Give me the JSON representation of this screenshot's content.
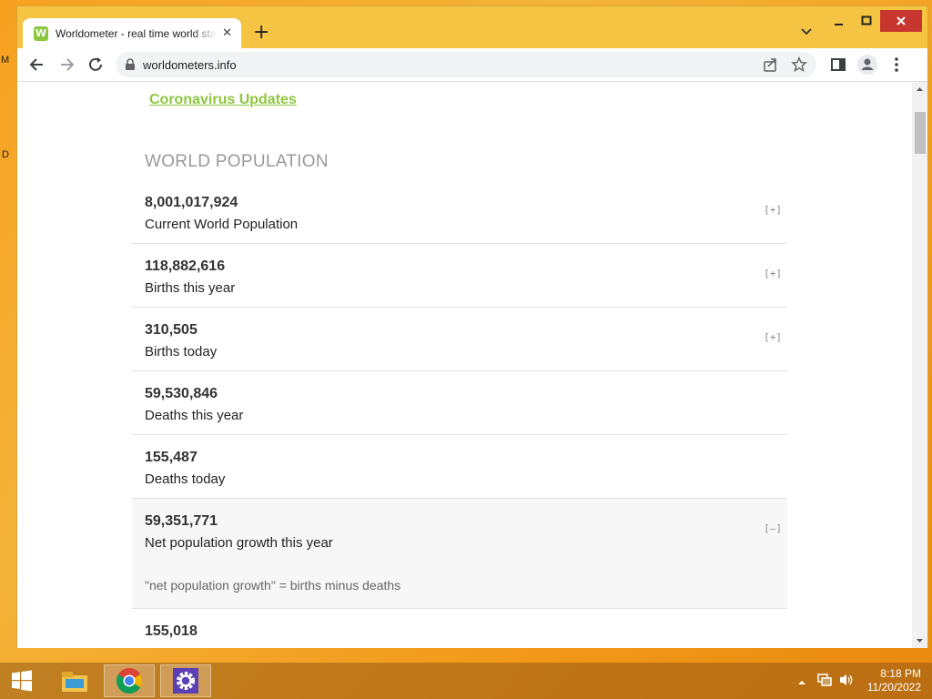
{
  "browser": {
    "tab_title": "Worldometer - real time world statistics",
    "favicon_letter": "W",
    "url": "worldometers.info"
  },
  "page": {
    "covid_link": "Coronavirus Updates",
    "section_title": "WORLD POPULATION",
    "rows": [
      {
        "value": "8,001,017,924",
        "label": "Current World Population",
        "toggle": "[+]"
      },
      {
        "value": "118,882,616",
        "label": "Births this year",
        "toggle": "[+]"
      },
      {
        "value": "310,505",
        "label": "Births today",
        "toggle": "[+]"
      },
      {
        "value": "59,530,846",
        "label": "Deaths this year",
        "toggle": ""
      },
      {
        "value": "155,487",
        "label": "Deaths today",
        "toggle": ""
      },
      {
        "value": "59,351,771",
        "label": "Net population growth this year",
        "toggle": "[–]",
        "note": "\"net population growth\" = births minus deaths"
      },
      {
        "value": "155,018",
        "label": "",
        "toggle": ""
      }
    ]
  },
  "taskbar": {
    "time": "8:18 PM",
    "date": "11/20/2022"
  },
  "desktop": {
    "fragment_1": "M",
    "fragment_2": "D"
  },
  "colors": {
    "accent": "#8dc63f",
    "window_frame": "#f6c443"
  }
}
